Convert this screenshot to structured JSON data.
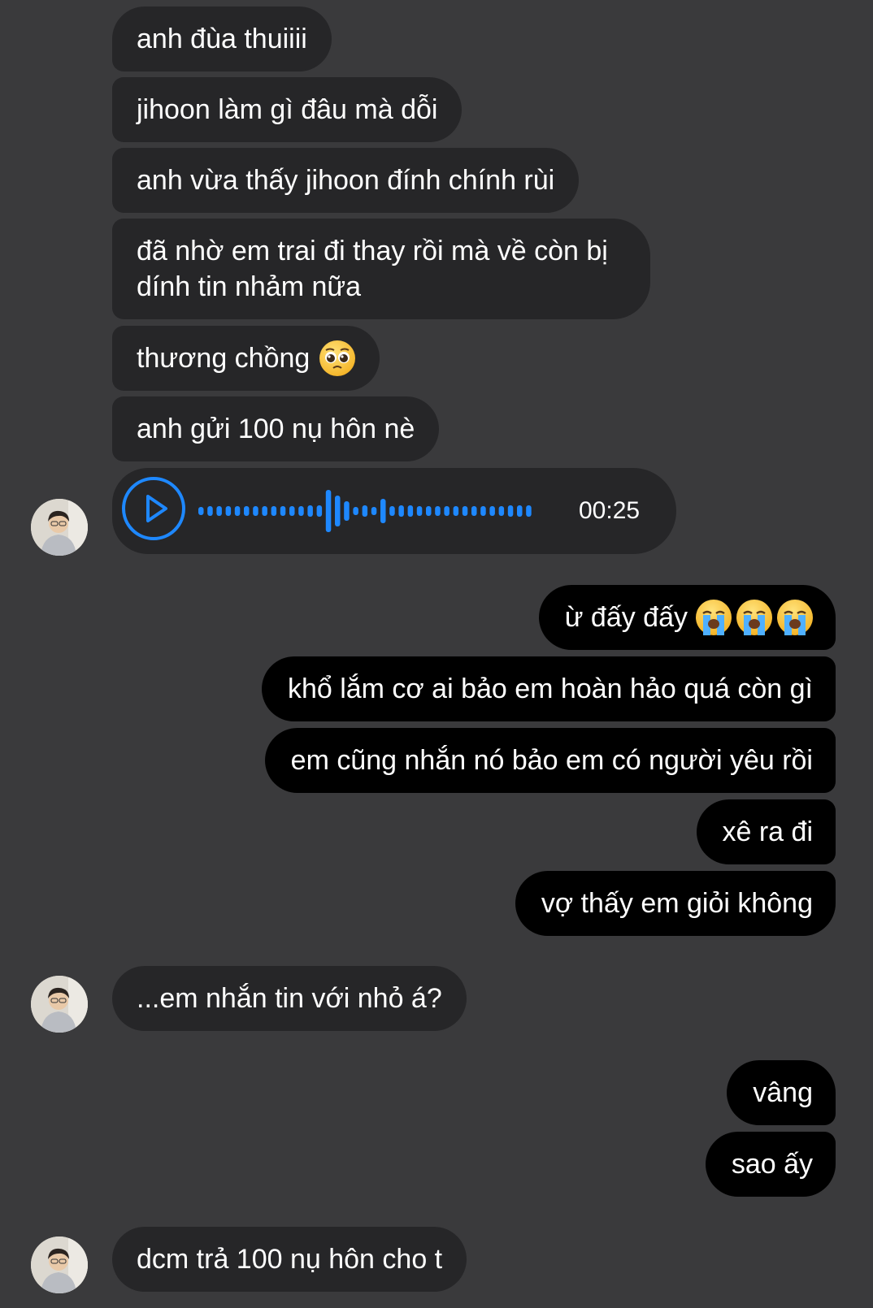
{
  "conversation": {
    "messages": [
      {
        "id": "m1",
        "side": "incoming",
        "text": "anh đùa thuiiii"
      },
      {
        "id": "m2",
        "side": "incoming",
        "text": "jihoon làm gì đâu mà dỗi"
      },
      {
        "id": "m3",
        "side": "incoming",
        "text": "anh vừa thấy jihoon đính chính rùi"
      },
      {
        "id": "m4",
        "side": "incoming",
        "line1": "đã nhờ em trai đi thay rồi mà về còn bị",
        "line2": "dính tin nhảm nữa"
      },
      {
        "id": "m5",
        "side": "incoming",
        "text": "thương chồng",
        "emoji": "pleading-face"
      },
      {
        "id": "m6",
        "side": "incoming",
        "text": "anh gửi 100 nụ hôn nè"
      },
      {
        "id": "m7",
        "side": "incoming",
        "type": "voice",
        "duration": "00:25"
      },
      {
        "id": "m8",
        "side": "outgoing",
        "text": "ừ đấy đấy",
        "emoji": [
          "loudly-crying-face",
          "loudly-crying-face",
          "loudly-crying-face"
        ]
      },
      {
        "id": "m9",
        "side": "outgoing",
        "text": "khổ lắm cơ ai bảo em hoàn hảo quá còn gì"
      },
      {
        "id": "m10",
        "side": "outgoing",
        "text": "em cũng nhắn nó bảo em có người yêu rồi"
      },
      {
        "id": "m11",
        "side": "outgoing",
        "text": "xê ra đi"
      },
      {
        "id": "m12",
        "side": "outgoing",
        "text": "vợ thấy em giỏi không"
      },
      {
        "id": "m13",
        "side": "incoming",
        "text": "...em nhắn tin với nhỏ á?"
      },
      {
        "id": "m14",
        "side": "outgoing",
        "text": "vâng"
      },
      {
        "id": "m15",
        "side": "outgoing",
        "text": "sao ấy"
      },
      {
        "id": "m16",
        "side": "incoming",
        "text": "dcm trả 100 nụ hôn cho t"
      }
    ]
  },
  "colors": {
    "background": "#3a3a3c",
    "incoming_bubble": "#262628",
    "outgoing_bubble": "#000000",
    "voice_accent": "#1e88ff"
  },
  "icons": {
    "play": "play-icon",
    "avatar": "contact-avatar"
  }
}
